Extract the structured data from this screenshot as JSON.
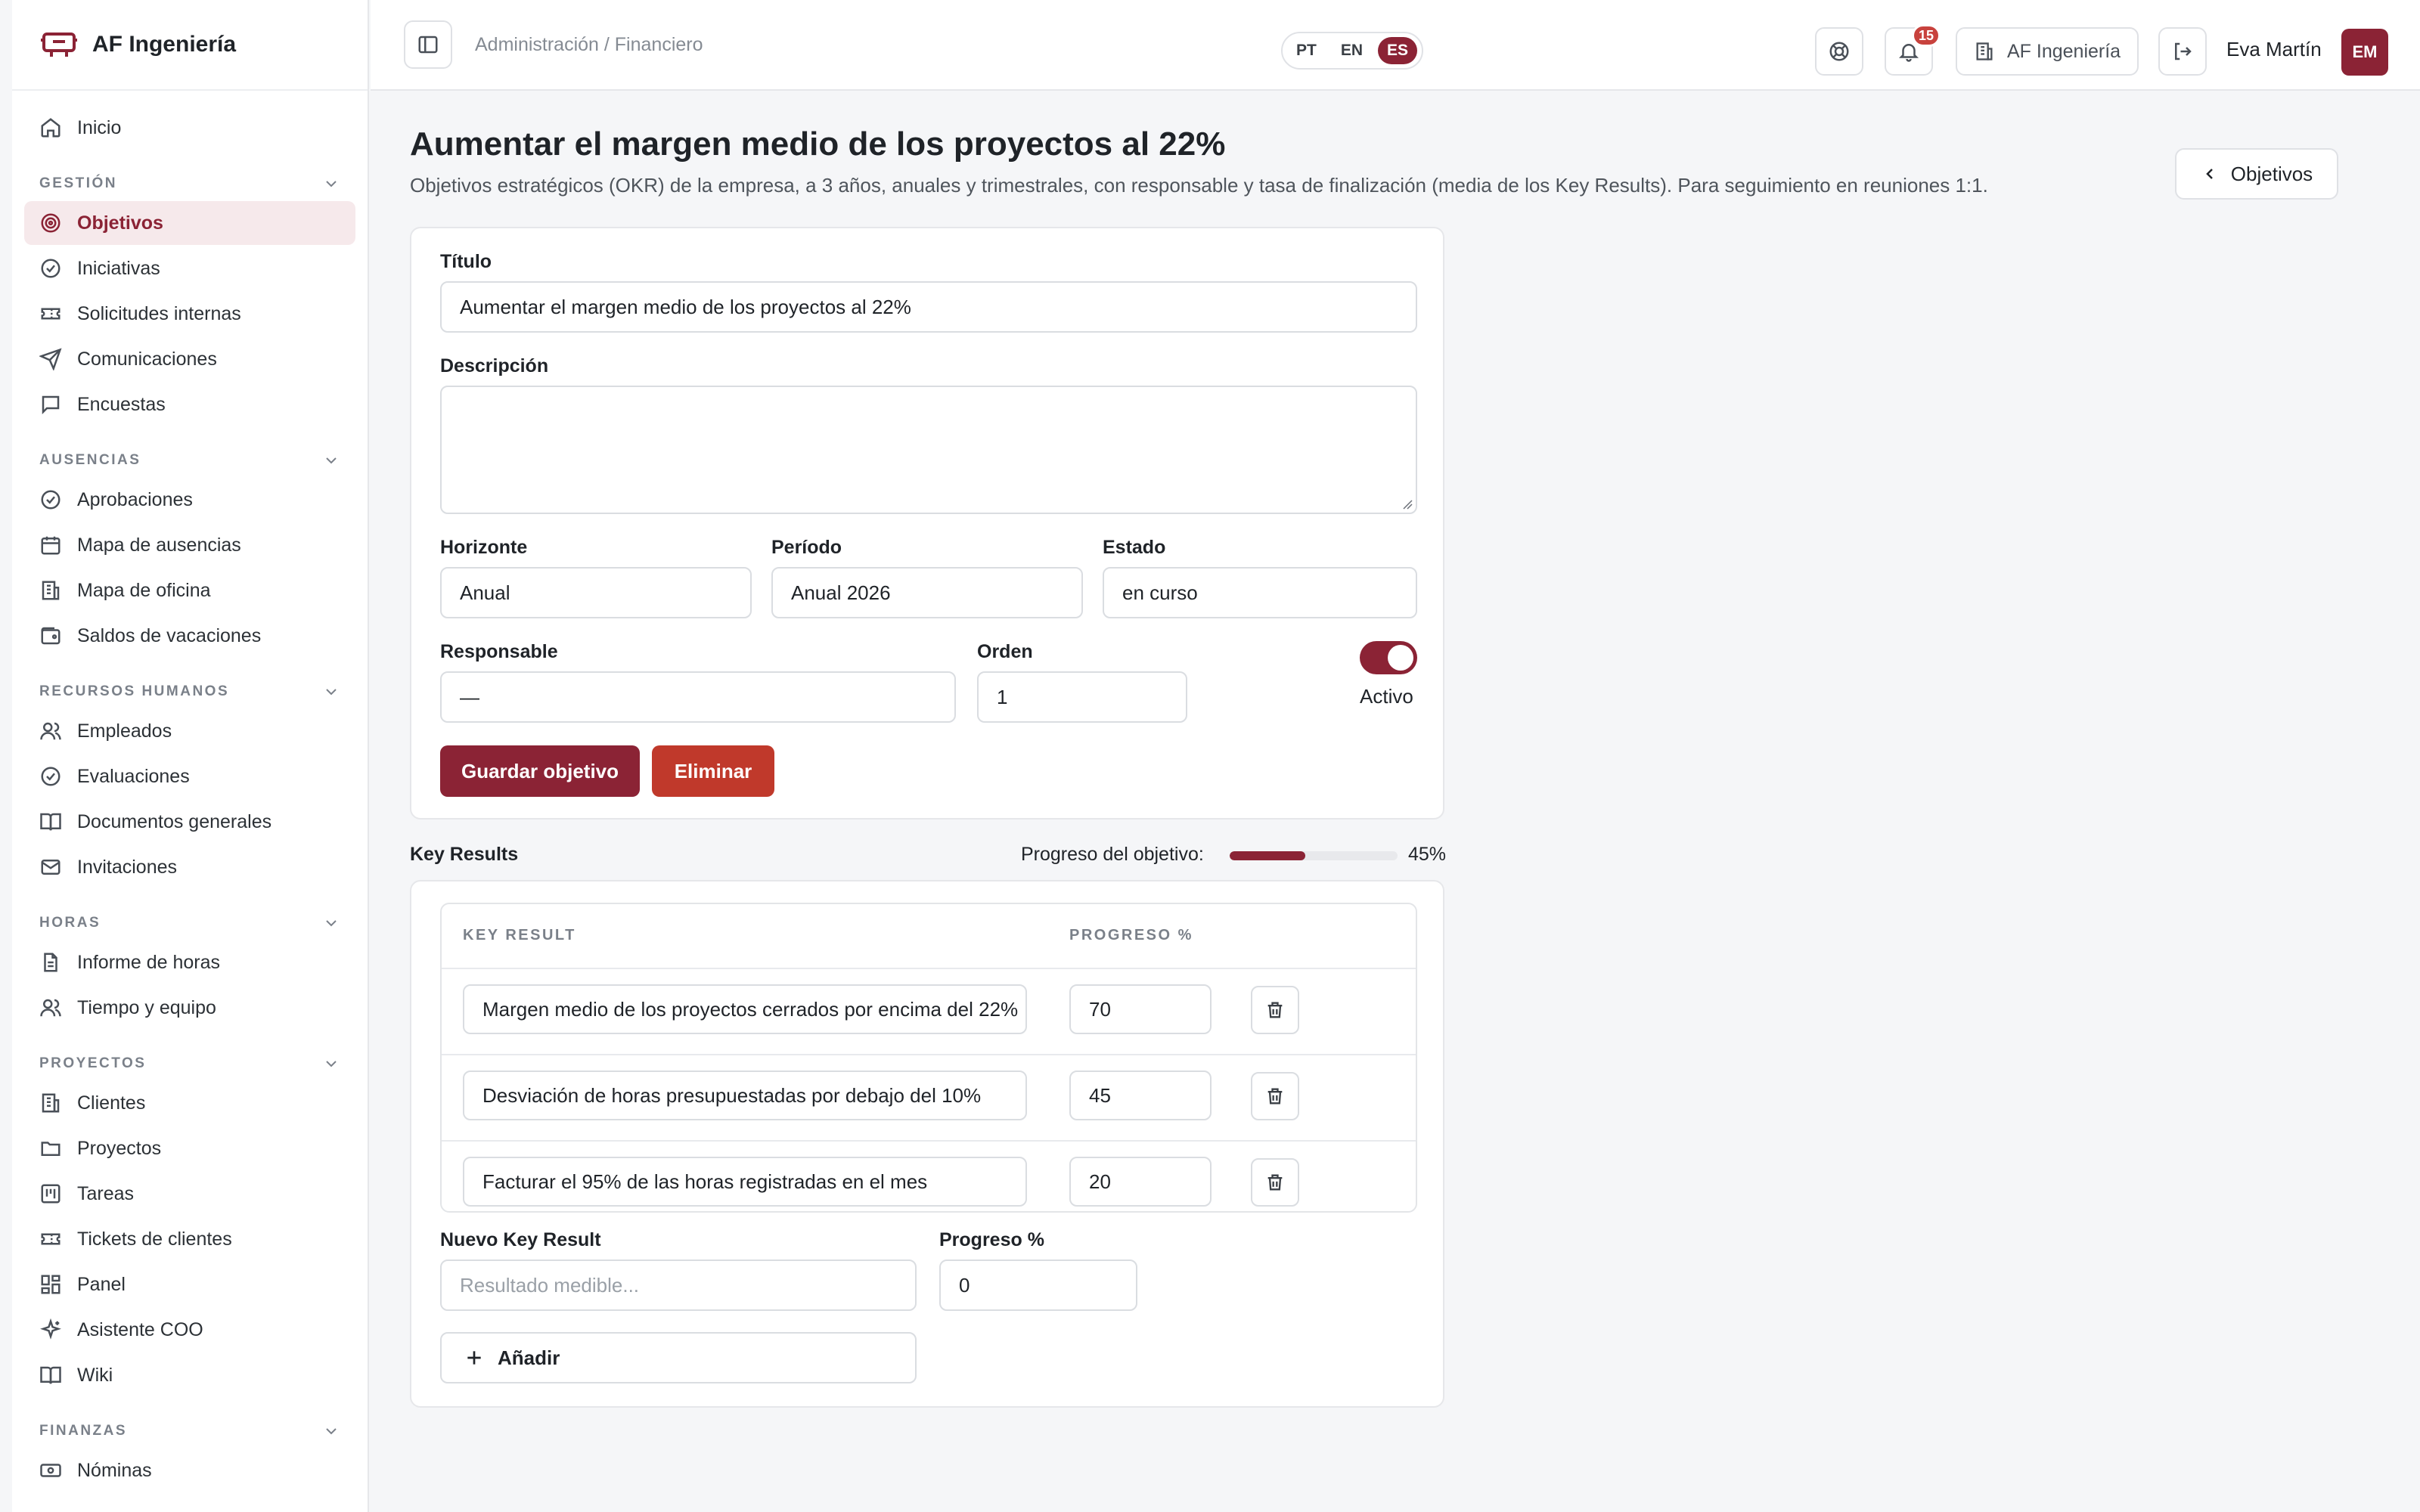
{
  "brand": {
    "name": "AF Ingeniería"
  },
  "sidebar": {
    "top": [
      {
        "label": "Inicio",
        "icon": "home-icon"
      }
    ],
    "sections": [
      {
        "title": "GESTIÓN",
        "items": [
          {
            "label": "Objetivos",
            "icon": "target-icon",
            "active": true
          },
          {
            "label": "Iniciativas",
            "icon": "check-circle-icon"
          },
          {
            "label": "Solicitudes internas",
            "icon": "ticket-icon"
          },
          {
            "label": "Comunicaciones",
            "icon": "send-icon"
          },
          {
            "label": "Encuestas",
            "icon": "message-square-icon"
          }
        ]
      },
      {
        "title": "AUSENCIAS",
        "items": [
          {
            "label": "Aprobaciones",
            "icon": "check-circle-icon"
          },
          {
            "label": "Mapa de ausencias",
            "icon": "calendar-icon"
          },
          {
            "label": "Mapa de oficina",
            "icon": "building-icon"
          },
          {
            "label": "Saldos de vacaciones",
            "icon": "wallet-icon"
          }
        ]
      },
      {
        "title": "RECURSOS HUMANOS",
        "items": [
          {
            "label": "Empleados",
            "icon": "users-icon"
          },
          {
            "label": "Evaluaciones",
            "icon": "check-circle-icon"
          },
          {
            "label": "Documentos generales",
            "icon": "book-icon"
          },
          {
            "label": "Invitaciones",
            "icon": "mail-icon"
          }
        ]
      },
      {
        "title": "HORAS",
        "items": [
          {
            "label": "Informe de horas",
            "icon": "file-text-icon"
          },
          {
            "label": "Tiempo y equipo",
            "icon": "users-icon"
          }
        ]
      },
      {
        "title": "PROYECTOS",
        "items": [
          {
            "label": "Clientes",
            "icon": "building-icon"
          },
          {
            "label": "Proyectos",
            "icon": "folder-icon"
          },
          {
            "label": "Tareas",
            "icon": "kanban-icon"
          },
          {
            "label": "Tickets de clientes",
            "icon": "ticket-icon"
          },
          {
            "label": "Panel",
            "icon": "dashboard-icon"
          },
          {
            "label": "Asistente COO",
            "icon": "sparkles-icon"
          },
          {
            "label": "Wiki",
            "icon": "book-icon"
          }
        ]
      },
      {
        "title": "FINANZAS",
        "items": [
          {
            "label": "Nóminas",
            "icon": "banknote-icon"
          }
        ]
      }
    ]
  },
  "topbar": {
    "breadcrumb": "Administración / Financiero",
    "languages": [
      "PT",
      "EN",
      "ES"
    ],
    "selected_language": "ES",
    "notifications_count": "15",
    "company": "AF Ingeniería",
    "user_name": "Eva Martín",
    "user_initials": "EM"
  },
  "page": {
    "title": "Aumentar el margen medio de los proyectos al 22%",
    "subtitle": "Objetivos estratégicos (OKR) de la empresa, a 3 años, anuales y trimestrales, con responsable y tasa de finalización (media de los Key Results). Para seguimiento en reuniones 1:1.",
    "back_label": "Objetivos"
  },
  "form": {
    "title_label": "Título",
    "title_value": "Aumentar el margen medio de los proyectos al 22%",
    "description_label": "Descripción",
    "description_value": "",
    "horizon_label": "Horizonte",
    "horizon_value": "Anual",
    "period_label": "Período",
    "period_value": "Anual 2026",
    "status_label": "Estado",
    "status_value": "en curso",
    "owner_label": "Responsable",
    "owner_value": "—",
    "order_label": "Orden",
    "order_value": "1",
    "active_label": "Activo",
    "active": true,
    "save_label": "Guardar objetivo",
    "delete_label": "Eliminar"
  },
  "key_results": {
    "heading": "Key Results",
    "progress_label": "Progreso del objetivo:",
    "progress_percent": 45,
    "progress_text": "45%",
    "columns": [
      "KEY RESULT",
      "PROGRESO %"
    ],
    "rows": [
      {
        "text": "Margen medio de los proyectos cerrados por encima del 22%",
        "progress": "70"
      },
      {
        "text": "Desviación de horas presupuestadas por debajo del 10%",
        "progress": "45"
      },
      {
        "text": "Facturar el 95% de las horas registradas en el mes",
        "progress": "20"
      }
    ],
    "new_label": "Nuevo Key Result",
    "new_placeholder": "Resultado medible...",
    "new_progress_label": "Progreso %",
    "new_progress_value": "0",
    "add_label": "Añadir"
  },
  "colors": {
    "accent": "#8b2335",
    "danger": "#c0392b"
  }
}
